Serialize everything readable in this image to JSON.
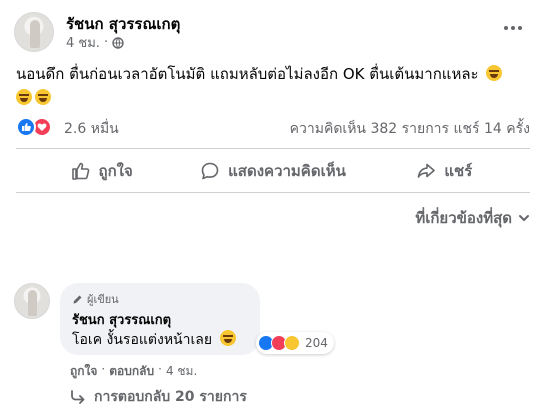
{
  "post": {
    "author": "รัชนก สุวรรณเกตุ",
    "time": "4 ชม.",
    "privacy_icon": "globe-icon",
    "text": "นอนดึก ตื่นก่อนเวลาอัตโนมัติ แถมหลับต่อไม่ลงอีก OK ตื่นเต้นมากแหละ",
    "emoji": "laughing-emoji"
  },
  "stats": {
    "reactions": "2.6 หมื่น",
    "comments_shares": "ความคิดเห็น 382 รายการ  แชร์ 14 ครั้ง"
  },
  "actions": {
    "like": "ถูกใจ",
    "comment": "แสดงความคิดเห็น",
    "share": "แชร์"
  },
  "sort_label": "ที่เกี่ยวข้องที่สุด",
  "comment": {
    "badge": "ผู้เขียน",
    "author": "รัชนก สุวรรณเกตุ",
    "text": "โอเค งั้นรอแต่งหน้าเลย",
    "reaction_count": "204",
    "like": "ถูกใจ",
    "reply": "ตอบกลับ",
    "time": "4 ชม.",
    "replies": "การตอบกลับ 20 รายการ"
  },
  "colors": {
    "like_blue": "#1877f2",
    "love_red": "#f33e58",
    "haha_yellow": "#f7c630",
    "secondary_text": "#65676b"
  }
}
